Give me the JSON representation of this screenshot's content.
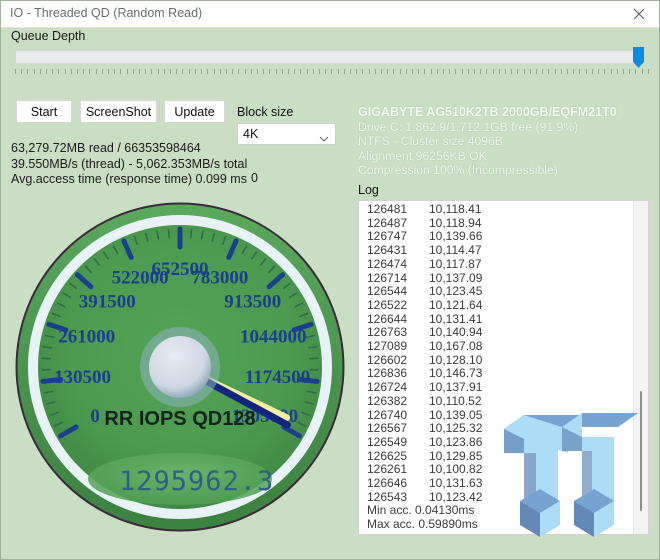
{
  "window": {
    "title": "IO - Threaded QD (Random Read)",
    "close_icon": "close-icon",
    "bg_color": "#c9dec3"
  },
  "queue_depth": {
    "label": "Queue Depth",
    "slider_position_percent": 100
  },
  "toolbar": {
    "start_label": "Start",
    "screenshot_label": "ScreenShot",
    "update_label": "Update"
  },
  "block_size": {
    "label": "Block size",
    "selected": "4K",
    "chevron_icon": "chevron-down-icon"
  },
  "stats": {
    "line1": "63,279.72MB read / 66353598464",
    "line2": "39.550MB/s (thread) - 5,062.353MB/s total",
    "line3": "Avg.access time (response time) 0.099 ms",
    "counter": "0"
  },
  "drive_info": {
    "model": "GIGABYTE AG510K2TB 2000GB/EQFM21T0",
    "capacity": "Drive C: 1,862.9/1,712.1GB free (91.9%)",
    "filesystem": "NTFS - Cluster size 4096B",
    "alignment": "Alignment 96256KB OK",
    "compression": "Compression 100% (Incompressible)"
  },
  "log": {
    "label": "Log",
    "rows": [
      {
        "iops": "126481",
        "mbs": "10,118.41"
      },
      {
        "iops": "126487",
        "mbs": "10,118.94"
      },
      {
        "iops": "126747",
        "mbs": "10,139.66"
      },
      {
        "iops": "126431",
        "mbs": "10,114.47"
      },
      {
        "iops": "126474",
        "mbs": "10,117.87"
      },
      {
        "iops": "126714",
        "mbs": "10,137.09"
      },
      {
        "iops": "126544",
        "mbs": "10,123.45"
      },
      {
        "iops": "126522",
        "mbs": "10,121.64"
      },
      {
        "iops": "126644",
        "mbs": "10,131.41"
      },
      {
        "iops": "126763",
        "mbs": "10,140.94"
      },
      {
        "iops": "127089",
        "mbs": "10,167.08"
      },
      {
        "iops": "126602",
        "mbs": "10,128.10"
      },
      {
        "iops": "126836",
        "mbs": "10,146.73"
      },
      {
        "iops": "126724",
        "mbs": "10,137.91"
      },
      {
        "iops": "126382",
        "mbs": "10,110.52"
      },
      {
        "iops": "126740",
        "mbs": "10,139.05"
      },
      {
        "iops": "126567",
        "mbs": "10,125.32"
      },
      {
        "iops": "126549",
        "mbs": "10,123.86"
      },
      {
        "iops": "126625",
        "mbs": "10,129.85"
      },
      {
        "iops": "126261",
        "mbs": "10,100.82"
      },
      {
        "iops": "126646",
        "mbs": "10,131.63"
      },
      {
        "iops": "126543",
        "mbs": "10,123.42"
      }
    ],
    "min_acc": "Min acc. 0.04130ms",
    "max_acc": "Max acc. 0.59890ms"
  },
  "gauge": {
    "caption": "RR IOPS QD128",
    "digital_readout": "1295962.3",
    "needle_value": 1295962.3,
    "secondary_needle_value": 1280000,
    "scale_min": 0,
    "scale_max": 1305000,
    "major_ticks": [
      {
        "value": 0,
        "label": "0"
      },
      {
        "value": 130500,
        "label": "130500"
      },
      {
        "value": 261000,
        "label": "261000"
      },
      {
        "value": 391500,
        "label": "391500"
      },
      {
        "value": 522000,
        "label": "522000"
      },
      {
        "value": 652500,
        "label": "652500"
      },
      {
        "value": 783000,
        "label": "783000"
      },
      {
        "value": 913500,
        "label": "913500"
      },
      {
        "value": 1044000,
        "label": "1044000"
      },
      {
        "value": 1174500,
        "label": "1174500"
      },
      {
        "value": 1305000,
        "label": "1305000"
      }
    ],
    "face_color": "#4f9e52",
    "tick_color": "#1b3f8f",
    "needle_color": "#13257e",
    "secondary_needle_color": "#f2eda0"
  },
  "watermark": {
    "name": "tweaktown-tt-logo",
    "color_light": "#a8dcf7",
    "color_mid": "#6f9fd0",
    "color_dark": "#5b83b5"
  }
}
